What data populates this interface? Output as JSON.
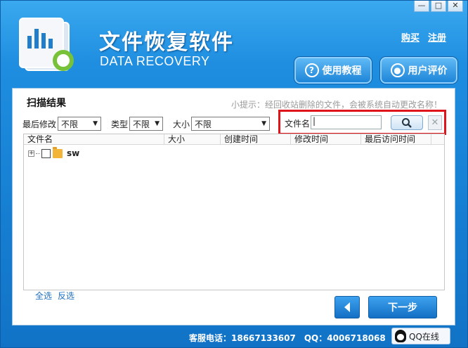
{
  "window": {
    "controls": {
      "minimize": "—",
      "restore": "□",
      "close": "✕"
    }
  },
  "app": {
    "title": "文件恢复软件",
    "subtitle": "DATA RECOVERY"
  },
  "header": {
    "links": {
      "buy": "购买",
      "register": "注册"
    },
    "buttons": {
      "tutorial": "使用教程",
      "review": "用户评价"
    }
  },
  "panel": {
    "title": "扫描结果",
    "tip": "小提示：经回收站删除的文件，会被系统自动更改名称！"
  },
  "filters": {
    "modified": {
      "label": "最后修改",
      "value": "不限"
    },
    "type": {
      "label": "类型",
      "value": "不限"
    },
    "size": {
      "label": "大小",
      "value": "不限"
    }
  },
  "search": {
    "label": "文件名",
    "value": ""
  },
  "table": {
    "columns": [
      "文件名",
      "大小",
      "创建时间",
      "修改时间",
      "最后访问时间"
    ],
    "rows": [
      {
        "name": "sw"
      }
    ]
  },
  "selection": {
    "select_all": "全选",
    "invert": "反选"
  },
  "nav": {
    "next": "下一步"
  },
  "footer": {
    "service": "客服电话：18667133607",
    "qq_number": "QQ：4006718068",
    "qq_online": "QQ在线"
  },
  "colors": {
    "accent": "#1f8ee0",
    "highlight_border": "#e0151b"
  }
}
